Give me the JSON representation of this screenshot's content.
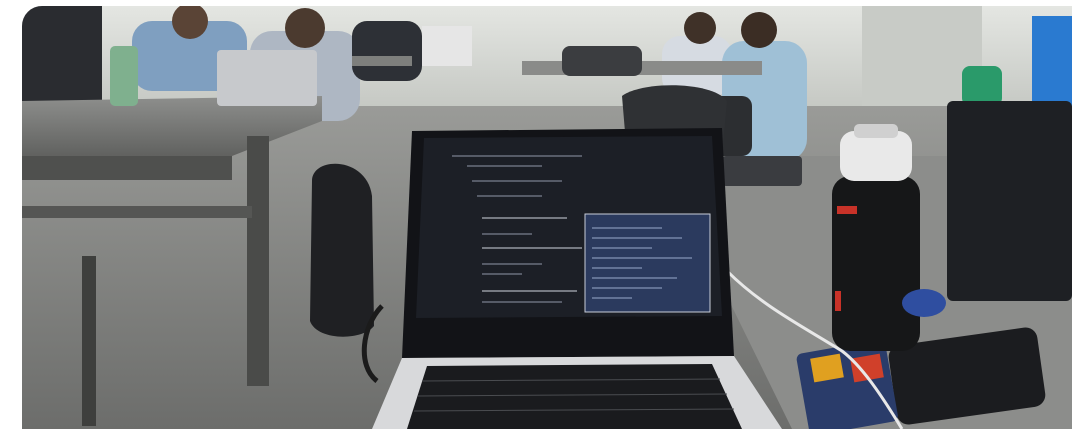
{
  "photo": {
    "scene": "laptop-on-desk-in-shared-workspace",
    "colors": {
      "floor": "#8a8b8a",
      "table": "#7a7b7a",
      "wall": "#d9dcd8",
      "screen": "#1c1f26",
      "terminal": "#2b3a5e",
      "bottle": "#1a1a1a",
      "bottle_cap": "#e9e9e9",
      "shirt_blue": "#7f9fc0",
      "hoodie": "#9fc0d6"
    }
  }
}
